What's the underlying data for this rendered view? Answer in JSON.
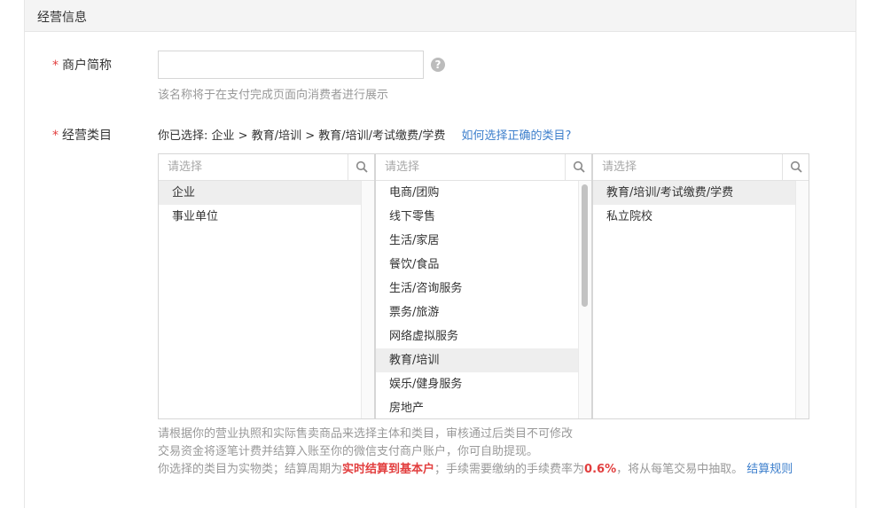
{
  "section": {
    "title": "经营信息"
  },
  "merchant_name": {
    "label": "商户简称",
    "required_mark": "*",
    "value": "",
    "placeholder": "",
    "help_icon": "question-circle-icon",
    "hint": "该名称将于在支付完成页面向消费者进行展示"
  },
  "category": {
    "label": "经营类目",
    "required_mark": "*",
    "selected_prefix": "你已选择:",
    "selected_path": "企业 > 教育/培训 > 教育/培训/考试缴费/学费",
    "help_link": "如何选择正确的类目?",
    "columns": [
      {
        "placeholder": "请选择",
        "search_icon": "search-icon",
        "items": [
          {
            "label": "企业",
            "active": true
          },
          {
            "label": "事业单位",
            "active": false
          }
        ]
      },
      {
        "placeholder": "请选择",
        "search_icon": "search-icon",
        "items": [
          {
            "label": "电商/团购",
            "active": false
          },
          {
            "label": "线下零售",
            "active": false
          },
          {
            "label": "生活/家居",
            "active": false
          },
          {
            "label": "餐饮/食品",
            "active": false
          },
          {
            "label": "生活/咨询服务",
            "active": false
          },
          {
            "label": "票务/旅游",
            "active": false
          },
          {
            "label": "网络虚拟服务",
            "active": false
          },
          {
            "label": "教育/培训",
            "active": true
          },
          {
            "label": "娱乐/健身服务",
            "active": false
          },
          {
            "label": "房地产",
            "active": false
          }
        ]
      },
      {
        "placeholder": "请选择",
        "search_icon": "search-icon",
        "items": [
          {
            "label": "教育/培训/考试缴费/学费",
            "active": true
          },
          {
            "label": "私立院校",
            "active": false
          }
        ]
      }
    ],
    "notes": {
      "line1": "请根据你的营业执照和实际售卖商品来选择主体和类目，审核通过后类目不可修改",
      "line2": "交易资金将逐笔计费并结算入账至你的微信支付商户账户，你可自助提现。",
      "line3_a": "你选择的类目为实物类；结算周期为",
      "line3_red1": "实时结算到基本户",
      "line3_b": "；手续需要缴纳的手续费率为",
      "line3_red2": "0.6%",
      "line3_c": "，将从每笔交易中抽取。",
      "line3_link": "结算规则"
    }
  },
  "colors": {
    "accent": "#3d7fcc",
    "required": "#e23e3e",
    "hint": "#999999"
  }
}
